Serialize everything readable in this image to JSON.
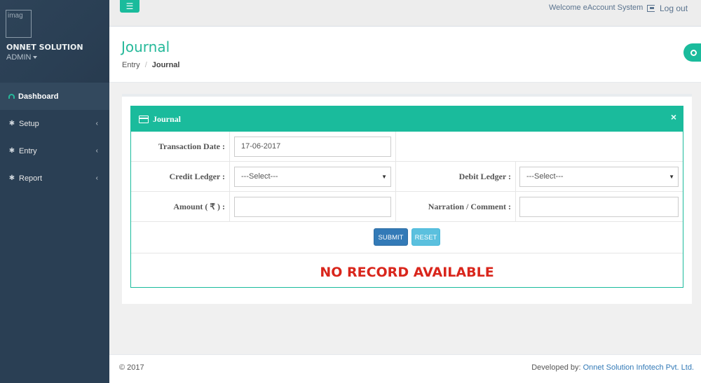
{
  "sidebar": {
    "logo_alt": "imag",
    "company": "ONNET SOLUTION",
    "role": "ADMIN",
    "items": [
      {
        "label": "Dashboard",
        "icon": "dashboard-icon"
      },
      {
        "label": "Setup",
        "icon": "gear-icon"
      },
      {
        "label": "Entry",
        "icon": "gear-icon"
      },
      {
        "label": "Report",
        "icon": "gear-icon"
      }
    ]
  },
  "topbar": {
    "welcome": "Welcome eAccount System",
    "logout": "Log out"
  },
  "header": {
    "title": "Journal",
    "breadcrumb": {
      "parent": "Entry",
      "current": "Journal"
    }
  },
  "form": {
    "panel_title": "Journal",
    "close": "×",
    "transaction_date_label": "Transaction Date :",
    "transaction_date_value": "17-06-2017",
    "credit_ledger_label": "Credit Ledger :",
    "credit_ledger_value": "---Select---",
    "debit_ledger_label": "Debit Ledger :",
    "debit_ledger_value": "---Select---",
    "amount_label": "Amount ( ₹ ) :",
    "amount_value": "",
    "narration_label": "Narration / Comment :",
    "narration_value": "",
    "submit": "SUBMIT",
    "reset": "RESET",
    "no_record": "NO RECORD AVAILABLE"
  },
  "footer": {
    "copyright": "© 2017",
    "developed_by": "Developed by: ",
    "developer": "Onnet Solution Infotech Pvt. Ltd."
  },
  "colors": {
    "accent": "#1abb9c",
    "sidebar": "#2a3f54",
    "no_record": "#d9261c",
    "submit": "#337ab7",
    "reset": "#5bc0de"
  }
}
